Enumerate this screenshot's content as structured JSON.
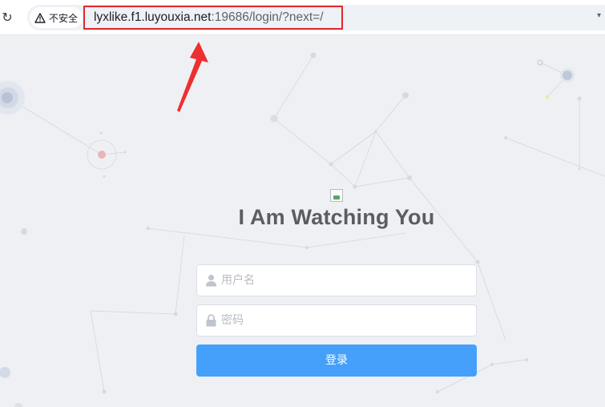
{
  "browser": {
    "security_label": "不安全",
    "url_host": "lyxlike.f1.luyouxia.net",
    "url_path": ":19686/login/?next=/",
    "reload_glyph": "↻",
    "menu_glyph": "▾"
  },
  "login": {
    "title": "I Am Watching You",
    "username_placeholder": "用户名",
    "password_placeholder": "密码",
    "submit_label": "登录"
  },
  "colors": {
    "page_background": "#eef0f4",
    "button": "#44a0fb",
    "url_highlight": "#e0282a",
    "arrow": "#ee2f2f"
  },
  "icons": [
    "reload-icon",
    "warning-icon",
    "user-icon",
    "lock-icon",
    "broken-image-icon",
    "red-arrow-annotation"
  ]
}
